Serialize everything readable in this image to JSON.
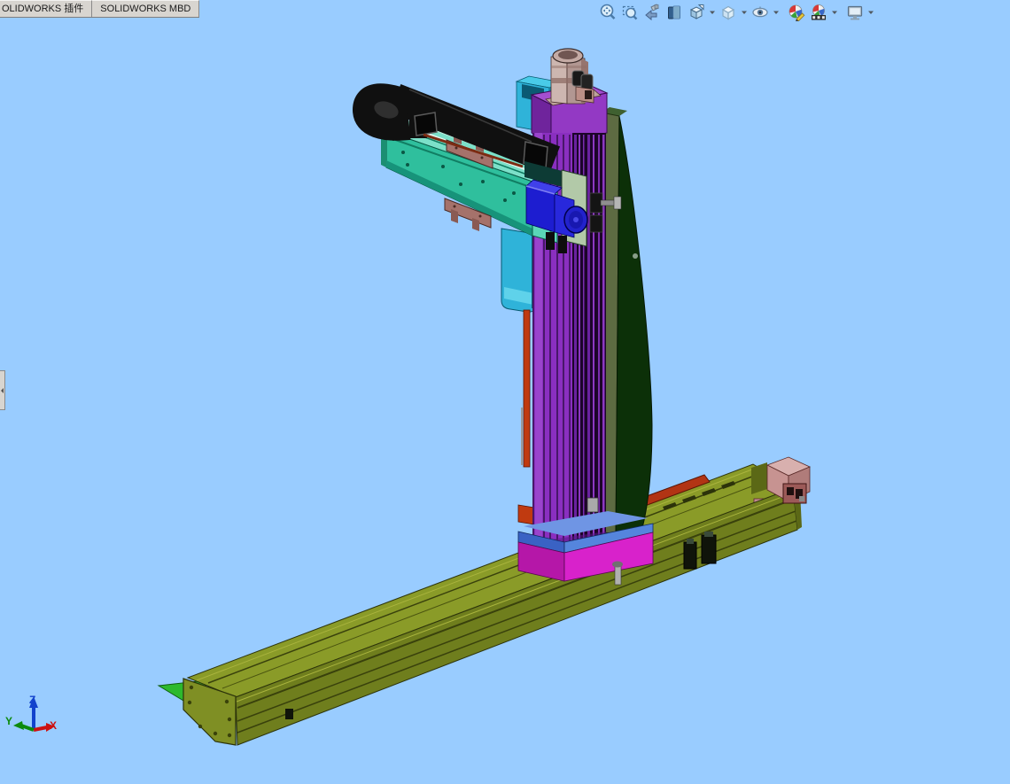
{
  "app": {
    "name": "SOLIDWORKS",
    "viewport_background": "#99ccff"
  },
  "tab_bar": {
    "tabs": [
      {
        "label": "OLIDWORKS 插件"
      },
      {
        "label": "SOLIDWORKS MBD"
      }
    ]
  },
  "left_flyout": {
    "name": "featuremanager-flyout-tab"
  },
  "view_toolbar": {
    "buttons": [
      {
        "name": "zoom-to-fit",
        "has_dropdown": false
      },
      {
        "name": "zoom-to-area",
        "has_dropdown": false
      },
      {
        "name": "previous-view",
        "has_dropdown": false
      },
      {
        "name": "section-view",
        "has_dropdown": false
      },
      {
        "name": "view-orientation",
        "has_dropdown": true
      },
      {
        "name": "display-style",
        "has_dropdown": true
      },
      {
        "name": "hide-show-items",
        "has_dropdown": true
      },
      {
        "name": "edit-appearance",
        "has_dropdown": false
      },
      {
        "name": "apply-scene",
        "has_dropdown": true
      },
      {
        "name": "view-settings",
        "has_dropdown": true
      }
    ]
  },
  "triad": {
    "x_label": "X",
    "y_label": "Y",
    "z_label": "Z",
    "x_color": "#cc1111",
    "y_color": "#0d8a0d",
    "z_color": "#1242cc"
  },
  "model": {
    "description": "3-axis cartesian gantry robot: olive linear base rail, purple vertical Z column, teal horizontal arm with black cable carrier, blue Z motor, pink axis motors, magenta carriage base",
    "parts": [
      "ground-plate",
      "base-rail",
      "rail-end-motor",
      "carriage-base",
      "z-column",
      "column-side-panel",
      "cyan-slide-plate",
      "horizontal-arm",
      "cable-carrier",
      "z-motor",
      "top-motor",
      "slider-blocks"
    ],
    "colors": {
      "ground_green": "#2db92d",
      "rail_top": "#8a9b28",
      "rail_front": "#6f7e1d",
      "rail_cap": "#7f8f24",
      "rail_end": "#5b6816",
      "red_strip": "#b23414",
      "orange_strip": "#c03a10",
      "end_motor_top": "#d8b0ae",
      "end_motor_front": "#c79391",
      "end_motor_side": "#b07c7a",
      "end_motor_clamp": "#9c5a58",
      "panel_dark_green": "#0c3008",
      "panel_olive_side": "#5d6b42",
      "panel_top": "#3f6030",
      "cyan_plate": "#2fb3d9",
      "cyan_light": "#5fd2ea",
      "cyan_top": "#49cbe8",
      "cyan_dark": "#0b5a73",
      "column_head_top": "#a44fd0",
      "column_head_left": "#6f249c",
      "column_head_right": "#9339c4",
      "column_purple": "#8a2fc0",
      "column_purple_light": "#9a44cc",
      "column_dark_zone": "#1c0529",
      "tower_pink_light": "#cdb6b0",
      "tower_pink_mid": "#b29792",
      "tower_pink_dark": "#96756f",
      "tower_base": "#bda49c",
      "arm_top": "#7ce0c9",
      "arm_front": "#2fbf9d",
      "arm_bottom_band": "#17937a",
      "arm_end_plate": "#5ad6b8",
      "arm_left_face": "#1b8e72",
      "slider_mauve": "#a5726b",
      "slider_mauve_dark": "#8a5a53",
      "chain_black": "#101010",
      "chain_face": "#070707",
      "motor_blue_front": "#1d1dd0",
      "motor_blue_top": "#4040ea",
      "motor_blue_box2": "#2828dc",
      "motor_cyl": "#2222cc",
      "sage_plate": "#b2c9a8",
      "dark_slab": "#0d3b35",
      "base_blue_left": "#3a62c4",
      "base_blue_right": "#5585dd",
      "base_magenta_left": "#b517a8",
      "base_magenta_right": "#d822cb"
    }
  }
}
